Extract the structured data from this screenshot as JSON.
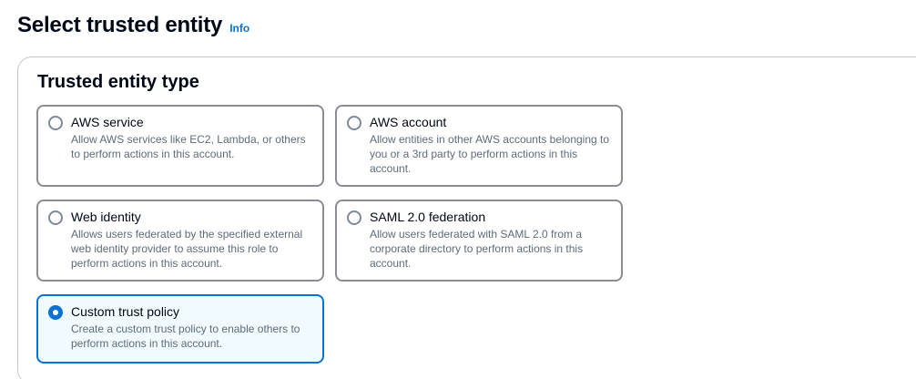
{
  "header": {
    "title": "Select trusted entity",
    "info_label": "Info"
  },
  "section": {
    "title": "Trusted entity type"
  },
  "options": [
    {
      "label": "AWS service",
      "description": "Allow AWS services like EC2, Lambda, or others to perform actions in this account.",
      "selected": false
    },
    {
      "label": "AWS account",
      "description": "Allow entities in other AWS accounts belonging to you or a 3rd party to perform actions in this account.",
      "selected": false
    },
    {
      "label": "Web identity",
      "description": "Allows users federated by the specified external web identity provider to assume this role to perform actions in this account.",
      "selected": false
    },
    {
      "label": "SAML 2.0 federation",
      "description": "Allow users federated with SAML 2.0 from a corporate directory to perform actions in this account.",
      "selected": false
    },
    {
      "label": "Custom trust policy",
      "description": "Create a custom trust policy to enable others to perform actions in this account.",
      "selected": true
    }
  ],
  "colors": {
    "accent": "#0972d3",
    "selected_background": "#f0fbff",
    "border": "#8c8c94"
  }
}
